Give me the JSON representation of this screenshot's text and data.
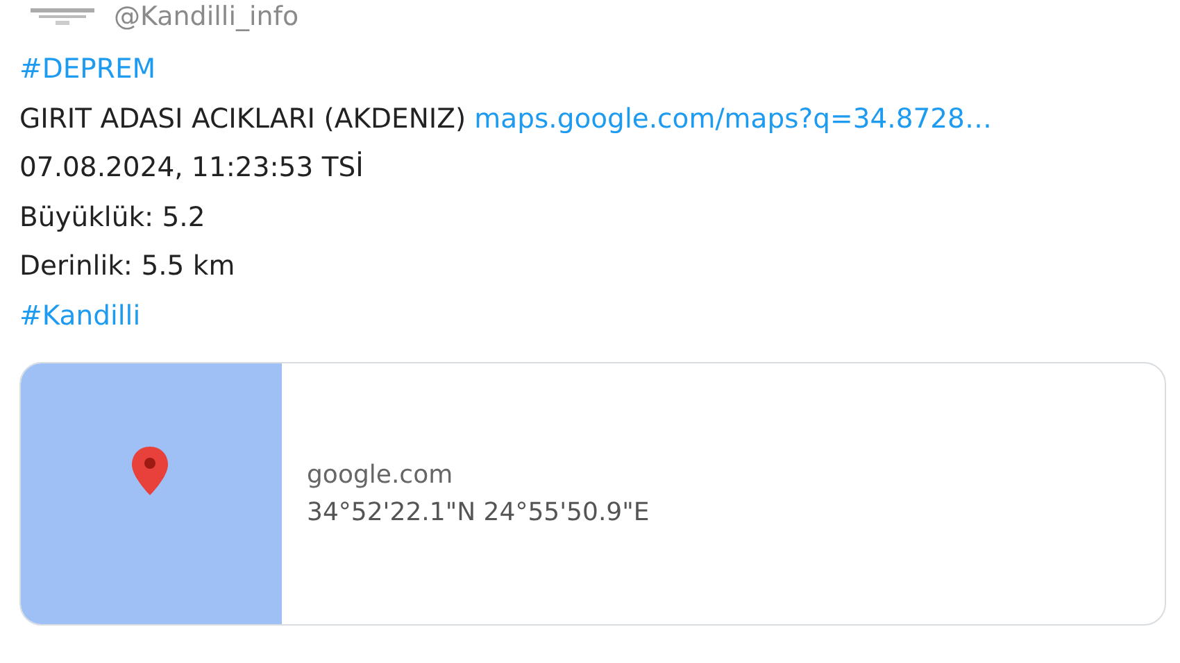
{
  "header": {
    "handle": "@Kandilli_info"
  },
  "lines": [
    [
      {
        "kind": "link",
        "text": "#DEPREM"
      }
    ],
    [
      {
        "kind": "text",
        "text": "GIRIT ADASI ACIKLARI (AKDENIZ)"
      },
      {
        "kind": "link",
        "text": "maps.google.com/maps?q=34.8728…"
      }
    ],
    [
      {
        "kind": "text",
        "text": "07.08.2024, 11:23:53 TSİ"
      }
    ],
    [
      {
        "kind": "text",
        "text": "Büyüklük: 5.2"
      }
    ],
    [
      {
        "kind": "text",
        "text": "Derinlik: 5.5 km"
      }
    ],
    [
      {
        "kind": "link",
        "text": "#Kandilli"
      }
    ]
  ],
  "card": {
    "domain": "google.com",
    "title": "34°52'22.1\"N 24°55'50.9\"E"
  }
}
